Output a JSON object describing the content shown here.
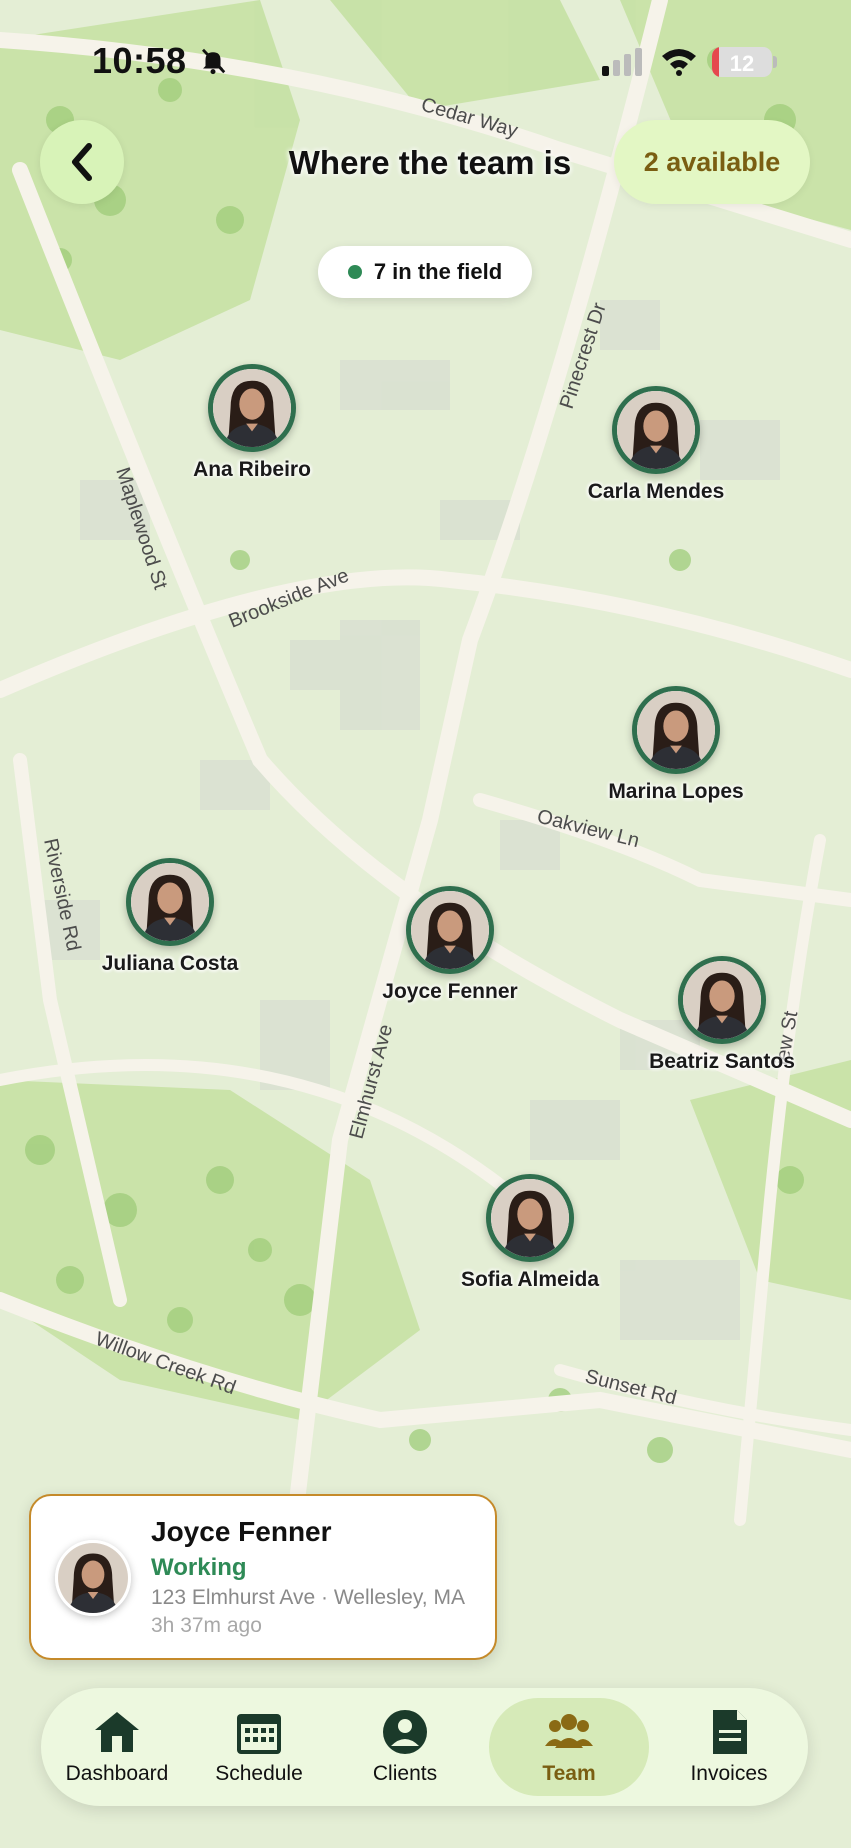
{
  "status_bar": {
    "time": "10:58",
    "battery": "12",
    "battery_level": 0.12
  },
  "header": {
    "title": "Where the team is",
    "available": "2 available"
  },
  "field_count": "7 in the field",
  "streets": {
    "cedar": "Cedar Way",
    "pinecrest": "Pinecrest Dr",
    "maplewood": "Maplewood St",
    "brookside": "Brookside Ave",
    "oakview": "Oakview Ln",
    "riverside": "Riverside Rd",
    "elmhurst": "Elmhurst Ave",
    "view": "iew St",
    "willow": "Willow Creek Rd",
    "sunset": "Sunset Rd"
  },
  "members": [
    {
      "name": "Ana Ribeiro"
    },
    {
      "name": "Carla Mendes"
    },
    {
      "name": "Marina Lopes"
    },
    {
      "name": "Juliana Costa"
    },
    {
      "name": "Joyce Fenner"
    },
    {
      "name": "Beatriz Santos"
    },
    {
      "name": "Sofia Almeida"
    }
  ],
  "selected": {
    "name": "Joyce Fenner",
    "status": "Working",
    "address": "123 Elmhurst Ave · Wellesley, MA",
    "ago": "3h 37m ago"
  },
  "tabs": [
    {
      "label": "Dashboard",
      "icon": "house-icon"
    },
    {
      "label": "Schedule",
      "icon": "calendar-icon"
    },
    {
      "label": "Clients",
      "icon": "person-icon"
    },
    {
      "label": "Team",
      "icon": "group-icon",
      "active": true
    },
    {
      "label": "Invoices",
      "icon": "document-icon"
    }
  ],
  "colors": {
    "accent_green": "#2e8a56",
    "marker_ring": "#2f6f4e",
    "gold": "#7a5e12",
    "card_border": "#c58a2a"
  }
}
